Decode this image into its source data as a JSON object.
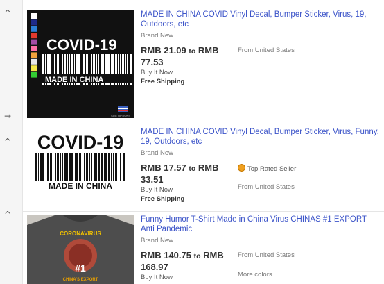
{
  "nav": {
    "collapse_icon_1": "^",
    "next_icon": "→",
    "collapse_icon_2": "^",
    "collapse_icon_3": "^"
  },
  "items": [
    {
      "title": "MADE IN CHINA COVID Vinyl Decal, Bumper Sticker, Virus, 19, Outdoors, etc",
      "condition": "Brand New",
      "price_low": "RMB 21.09",
      "price_to": "to",
      "price_high": "RMB 77.53",
      "location": "From United States",
      "buy_format": "Buy It Now",
      "shipping": "Free Shipping",
      "image": {
        "headline": "COVID-19",
        "subline": "MADE IN CHINA",
        "footer": "SIZE OPTIONS"
      }
    },
    {
      "title": "MADE IN CHINA COVID Vinyl Decal, Bumper Sticker, Virus, Funny, 19, Outdoors, etc",
      "condition": "Brand New",
      "price_low": "RMB 17.57",
      "price_to": "to",
      "price_high": "RMB 33.51",
      "seller_badge": "Top Rated Seller",
      "location": "From United States",
      "buy_format": "Buy It Now",
      "shipping": "Free Shipping",
      "image": {
        "headline": "COVID-19",
        "subline": "MADE IN CHINA"
      }
    },
    {
      "title": "Funny Humor T-Shirt Made in China Virus CHINAS #1 EXPORT Anti Pandemic",
      "condition": "Brand New",
      "price_low": "RMB 140.75",
      "price_to": "to",
      "price_high": "RMB 168.97",
      "location": "From United States",
      "buy_format": "Buy It Now",
      "extra": "More colors",
      "image": {
        "top_text": "CORONAVIRUS",
        "badge": "#1",
        "bottom_text": "CHINA'S EXPORT"
      }
    }
  ],
  "colors": {
    "link": "#3c54c9",
    "swatches": [
      "#ffffff",
      "#1e2a8a",
      "#2c7fd6",
      "#e03a2f",
      "#a64ca6",
      "#ff6fa8",
      "#f2a23c",
      "#e8e8e8",
      "#f5e84a",
      "#33cc33"
    ]
  }
}
